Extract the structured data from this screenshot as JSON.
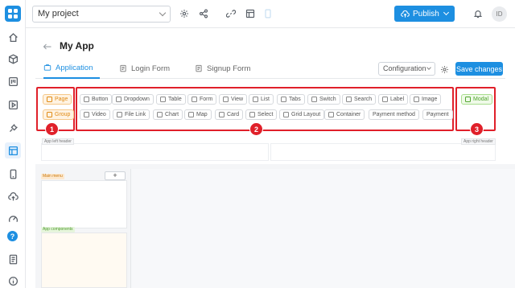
{
  "topbar": {
    "project_name": "My project",
    "publish_label": "Publish",
    "avatar_initials": "ID"
  },
  "page": {
    "title": "My App"
  },
  "tabs": [
    {
      "label": "Application",
      "active": true
    },
    {
      "label": "Login Form",
      "active": false
    },
    {
      "label": "Signup Form",
      "active": false
    }
  ],
  "config": {
    "select_label": "Configuration",
    "save_label": "Save changes"
  },
  "palette": {
    "layout": [
      "Page",
      "Group"
    ],
    "components_row1": [
      "Button",
      "Dropdown",
      "Table",
      "Form",
      "View",
      "List",
      "Tabs",
      "Switch",
      "Search",
      "Label",
      "Image"
    ],
    "components_row2": [
      "Video",
      "File Link",
      "Chart",
      "Map",
      "Card",
      "Select",
      "Grid Layout",
      "Container",
      "Payment method",
      "Payment"
    ],
    "overlay": [
      "Modal"
    ]
  },
  "badges": [
    "1",
    "2",
    "3"
  ],
  "zones": {
    "left_header": "App left header",
    "right_header": "App right header",
    "main_menu": "Main menu",
    "app_components": "App components",
    "add_symbol": "+"
  },
  "colors": {
    "accent": "#1d8fe1",
    "highlight": "#e0202a",
    "layout_chip": "#e08a14",
    "overlay_chip": "#52a530"
  },
  "help_symbol": "?"
}
